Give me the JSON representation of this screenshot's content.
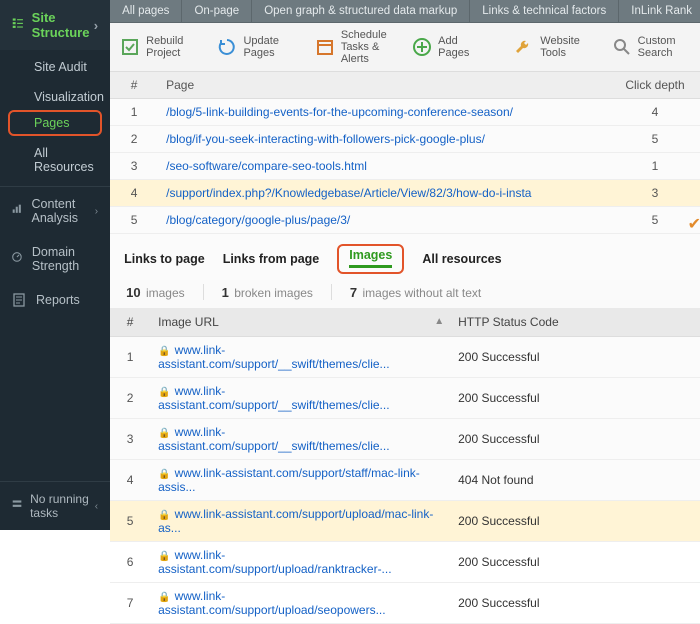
{
  "sidebar": {
    "head": "Site Structure",
    "items": [
      "Site Audit",
      "Visualization",
      "Pages",
      "All Resources"
    ],
    "content_analysis": "Content Analysis",
    "domain_strength": "Domain Strength",
    "reports": "Reports",
    "footer": "No running tasks"
  },
  "top_tabs": [
    "All pages",
    "On-page",
    "Open graph & structured data markup",
    "Links & technical factors",
    "InLink Rank"
  ],
  "toolbar": {
    "rebuild": "Rebuild Project",
    "update": "Update Pages",
    "schedule": "Schedule Tasks & Alerts",
    "add": "Add Pages",
    "tools": "Website Tools",
    "search": "Custom Search"
  },
  "table1": {
    "head": {
      "num": "#",
      "page": "Page",
      "depth": "Click depth"
    },
    "rows": [
      {
        "n": 1,
        "page": "/blog/5-link-building-events-for-the-upcoming-conference-season/",
        "d": 4
      },
      {
        "n": 2,
        "page": "/blog/if-you-seek-interacting-with-followers-pick-google-plus/",
        "d": 5
      },
      {
        "n": 3,
        "page": "/seo-software/compare-seo-tools.html",
        "d": 1
      },
      {
        "n": 4,
        "page": "/support/index.php?/Knowledgebase/Article/View/82/3/how-do-i-insta",
        "d": 3,
        "hl": true
      },
      {
        "n": 5,
        "page": "/blog/category/google-plus/page/3/",
        "d": 5
      }
    ]
  },
  "subtabs": {
    "links_to": "Links to page",
    "links_from": "Links from page",
    "images": "Images",
    "all": "All resources"
  },
  "stats": {
    "images_n": "10",
    "images_l": "images",
    "broken_n": "1",
    "broken_l": "broken images",
    "noalt_n": "7",
    "noalt_l": "images without alt text"
  },
  "table2": {
    "head": {
      "num": "#",
      "url": "Image URL",
      "status": "HTTP Status Code"
    },
    "rows": [
      {
        "n": 1,
        "url": "www.link-assistant.com/support/__swift/themes/clie...",
        "s": "200 Successful"
      },
      {
        "n": 2,
        "url": "www.link-assistant.com/support/__swift/themes/clie...",
        "s": "200 Successful"
      },
      {
        "n": 3,
        "url": "www.link-assistant.com/support/__swift/themes/clie...",
        "s": "200 Successful"
      },
      {
        "n": 4,
        "url": "www.link-assistant.com/support/staff/mac-link-assis...",
        "s": "404 Not found"
      },
      {
        "n": 5,
        "url": "www.link-assistant.com/support/upload/mac-link-as...",
        "s": "200 Successful",
        "hl": true
      },
      {
        "n": 6,
        "url": "www.link-assistant.com/support/upload/ranktracker-...",
        "s": "200 Successful"
      },
      {
        "n": 7,
        "url": "www.link-assistant.com/support/upload/seopowers...",
        "s": "200 Successful"
      }
    ]
  }
}
